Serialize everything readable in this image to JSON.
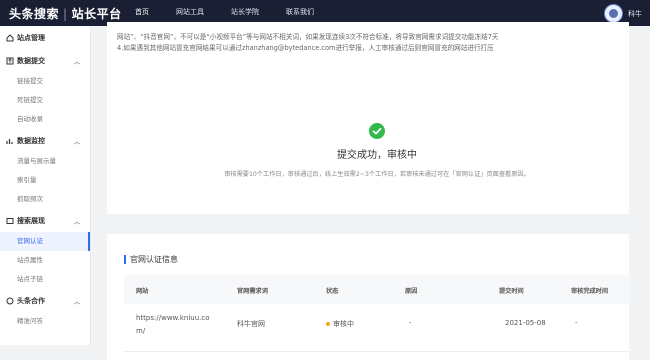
{
  "header": {
    "brand": "头条搜索",
    "brand_sub": "站长平台",
    "nav": [
      "首页",
      "网站工具",
      "站长学院",
      "联系我们"
    ],
    "active_nav": 0,
    "user_name": "科牛"
  },
  "sidebar": {
    "groups": [
      {
        "label": "站点管理",
        "icon": "home-icon",
        "items": []
      },
      {
        "label": "数据提交",
        "icon": "upload-icon",
        "items": [
          "链接提交",
          "死链提交",
          "自动收录"
        ]
      },
      {
        "label": "数据监控",
        "icon": "chart-icon",
        "items": [
          "流量与展示量",
          "索引量",
          "抓取频次"
        ]
      },
      {
        "label": "搜索展现",
        "icon": "search-display-icon",
        "items": [
          "官网认证",
          "站点属性",
          "站点子链"
        ]
      },
      {
        "label": "头条合作",
        "icon": "cooperation-icon",
        "items": [
          "精准问答"
        ]
      }
    ],
    "active_item": "官网认证"
  },
  "notice": {
    "line1": "网站”、“抖音官网”，不可以是“小视频平台”等与网站不相关词，如果发现连续3次不符合标准，将导致官网需求词提交功能冻结7天",
    "line2": "4.如果遇到其他网站冒充官网结果可以通过zhanzhang@bytedance.com进行举报，人工审核通过后则官网冒充的网站进行打压"
  },
  "success": {
    "title": "提交成功，审核中",
    "desc": "审核需要10个工作日，审核通过后，线上生效需2~3个工作日，若审核未通过可在「官网认证」页面查看原因。"
  },
  "info": {
    "title": "官网认证信息",
    "columns": [
      "网站",
      "官网需求词",
      "状态",
      "原因",
      "提交时间",
      "审核完成时间"
    ],
    "row": {
      "site_line1": "https://www.kniuu.co",
      "site_line2": "m/",
      "keyword": "科牛官网",
      "status": "审核中",
      "reason": "-",
      "submit_time": "2021-05-08",
      "finish_time": "-"
    },
    "status_color": "#f5a623"
  }
}
